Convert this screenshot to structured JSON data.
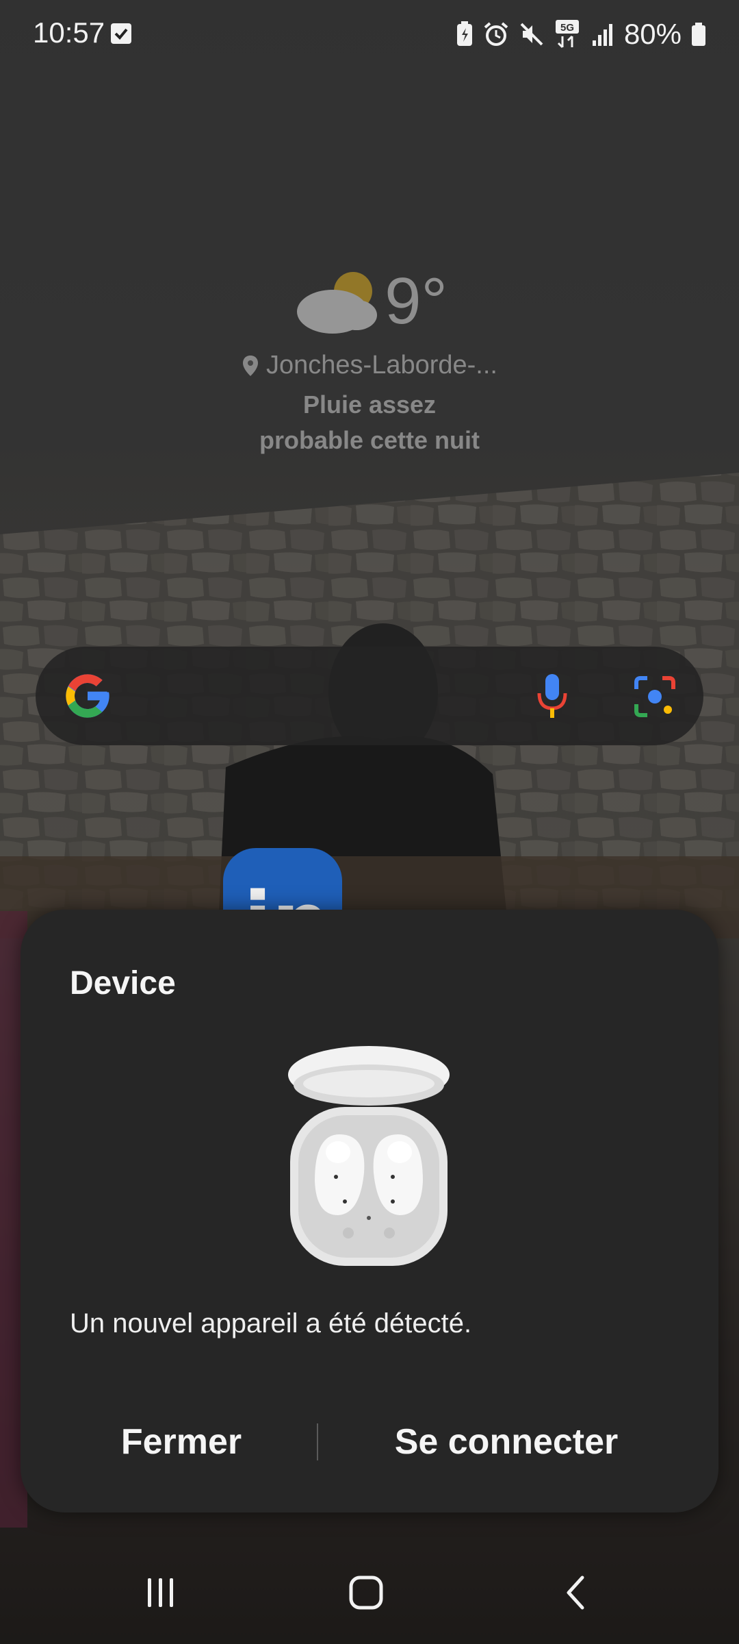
{
  "status_bar": {
    "time": "10:57",
    "battery_percent": "80%",
    "icons": [
      "check-icon",
      "battery-saver-icon",
      "alarm-icon",
      "mute-icon",
      "5g-icon",
      "signal-icon",
      "battery-icon"
    ]
  },
  "weather": {
    "temperature": "9°",
    "location": "Jonches-Laborde-...",
    "forecast_line1": "Pluie assez",
    "forecast_line2": "probable cette nuit",
    "icon": "partly-cloudy-icon"
  },
  "search_bar": {
    "icons": [
      "google-icon",
      "mic-icon",
      "lens-icon"
    ]
  },
  "dialog": {
    "title": "Device",
    "message": "Un nouvel appareil a été détecté.",
    "close_label": "Fermer",
    "connect_label": "Se connecter",
    "image": "earbuds-case-icon"
  },
  "colors": {
    "dialog_bg": "#262626",
    "google_blue": "#4285F4",
    "google_red": "#EA4335",
    "google_yellow": "#FBBC05",
    "google_green": "#34A853"
  },
  "nav_bar": {
    "icons": [
      "recents-icon",
      "home-icon",
      "back-icon"
    ]
  }
}
